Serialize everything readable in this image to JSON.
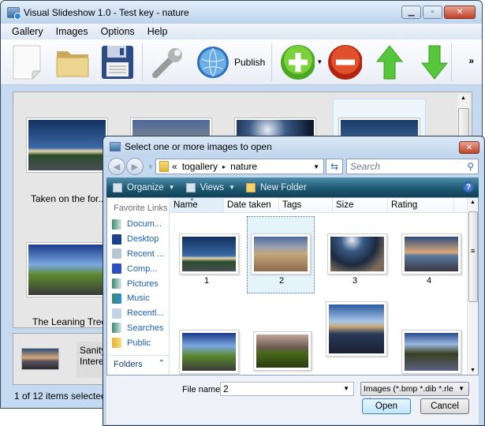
{
  "app": {
    "title": "Visual Slideshow 1.0 - Test key - nature",
    "window_buttons": [
      "minimize-icon",
      "maximize-icon",
      "close-icon"
    ]
  },
  "menu": [
    "Gallery",
    "Images",
    "Options",
    "Help"
  ],
  "toolbar": {
    "items": [
      "new-document-icon",
      "open-folder-icon",
      "save-disk-icon",
      "wrench-icon",
      "globe-icon",
      "add-icon",
      "remove-icon",
      "arrow-up-icon",
      "arrow-down-icon"
    ],
    "publish_label": "Publish",
    "more": "»"
  },
  "gallery": {
    "items": [
      {
        "caption": "Taken on the for..."
      },
      {
        "caption": ""
      },
      {
        "caption": ""
      },
      {
        "caption": ""
      },
      {
        "caption": "The Leaning Tree"
      }
    ],
    "detail_text_line1": "Sanity Ca",
    "detail_text_line2": "Interestin"
  },
  "status": "1 of 12 items selected",
  "dialog": {
    "title": "Select one or more images to open",
    "address": {
      "prefix": "«",
      "crumbs": [
        "togallery",
        "nature"
      ],
      "separator": "▸"
    },
    "search_placeholder": "Search",
    "commands": [
      {
        "label": "Organize",
        "dropdown": true
      },
      {
        "label": "Views",
        "dropdown": true
      },
      {
        "label": "New Folder",
        "dropdown": false
      }
    ],
    "favorites_header": "Favorite Links",
    "favorites": [
      "Docum...",
      "Desktop",
      "Recent ...",
      "Comp...",
      "Pictures",
      "Music",
      "Recentl...",
      "Searches",
      "Public"
    ],
    "folders_label": "Folders",
    "columns": [
      "Name",
      "Date taken",
      "Tags",
      "Size",
      "Rating"
    ],
    "sorted_column": "Name",
    "files": [
      {
        "label": "1",
        "selected": false
      },
      {
        "label": "2",
        "selected": true
      },
      {
        "label": "3",
        "selected": false
      },
      {
        "label": "4",
        "selected": false
      },
      {
        "label": "",
        "selected": false
      },
      {
        "label": "",
        "selected": false
      },
      {
        "label": "",
        "selected": false
      },
      {
        "label": "",
        "selected": false
      }
    ],
    "filename_label": "File name:",
    "filename_value": "2",
    "filetype_value": "Images (*.bmp *.dib *.rle *.jpg",
    "open_label": "Open",
    "cancel_label": "Cancel"
  }
}
